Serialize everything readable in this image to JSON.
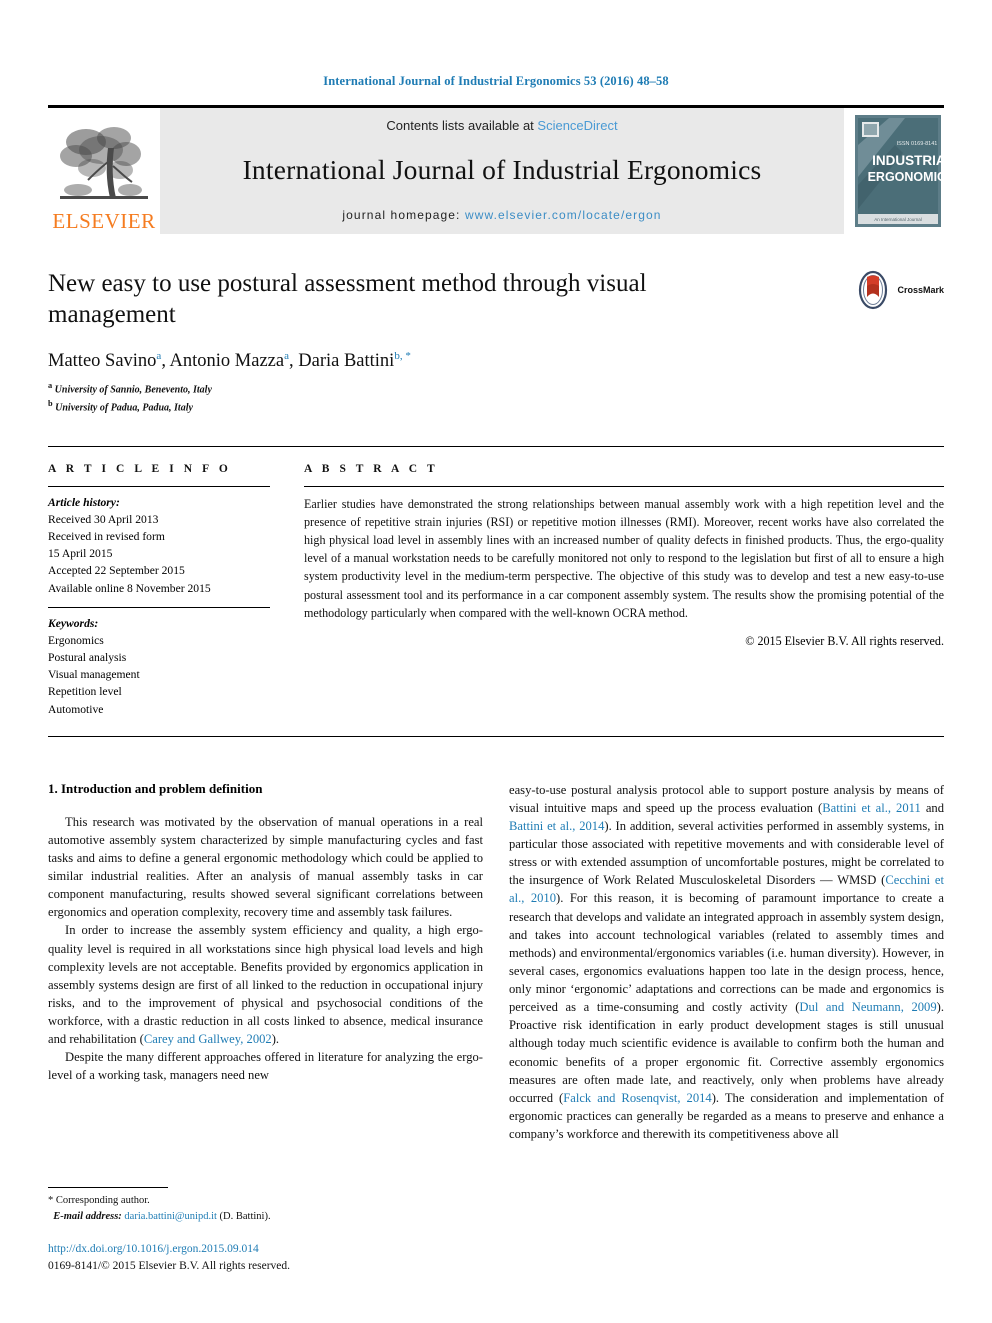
{
  "running_head": "International Journal of Industrial Ergonomics 53 (2016) 48–58",
  "masthead": {
    "contents_prefix": "Contents lists available at ",
    "sciencedirect": "ScienceDirect",
    "journal_name": "International Journal of Industrial Ergonomics",
    "homepage_prefix": "journal homepage: ",
    "homepage_url": "www.elsevier.com/locate/ergon",
    "publisher_word": "ELSEVIER",
    "cover": {
      "issn_text": "ISSN 0169-8141",
      "line1": "INDUSTRIAL",
      "line2": "ERGONOMICS",
      "footer_text": "An International Journal"
    }
  },
  "title": "New easy to use postural assessment method through visual management",
  "authors": {
    "full_line": "Matteo Savino a, Antonio Mazza a, Daria Battini b, *",
    "list": [
      {
        "name": "Matteo Savino",
        "marks": "a"
      },
      {
        "name": "Antonio Mazza",
        "marks": "a"
      },
      {
        "name": "Daria Battini",
        "marks": "b, *"
      }
    ]
  },
  "affiliations": [
    {
      "mark": "a",
      "text": "University of Sannio, Benevento, Italy"
    },
    {
      "mark": "b",
      "text": "University of Padua, Padua, Italy"
    }
  ],
  "crossmark": {
    "label": "CrossMark"
  },
  "article_info": {
    "heading": "A R T I C L E  I N F O",
    "history_label": "Article history:",
    "history": [
      "Received 30 April 2013",
      "Received in revised form",
      "15 April 2015",
      "Accepted 22 September 2015",
      "Available online 8 November 2015"
    ],
    "keywords_label": "Keywords:",
    "keywords": [
      "Ergonomics",
      "Postural analysis",
      "Visual management",
      "Repetition level",
      "Automotive"
    ]
  },
  "abstract": {
    "heading": "A B S T R A C T",
    "text": "Earlier studies have demonstrated the strong relationships between manual assembly work with a high repetition level and the presence of repetitive strain injuries (RSI) or repetitive motion illnesses (RMI). Moreover, recent works have also correlated the high physical load level in assembly lines with an increased number of quality defects in finished products. Thus, the ergo-quality level of a manual workstation needs to be carefully monitored not only to respond to the legislation but first of all to ensure a high system productivity level in the medium-term perspective. The objective of this study was to develop and test a new easy-to-use postural assessment tool and its performance in a car component assembly system. The results show the promising potential of the methodology particularly when compared with the well-known OCRA method.",
    "copyright": "© 2015 Elsevier B.V. All rights reserved."
  },
  "section": {
    "heading": "1. Introduction and problem definition"
  },
  "left_column": {
    "para1": "This research was motivated by the observation of manual operations in a real automotive assembly system characterized by simple manufacturing cycles and fast tasks and aims to define a general ergonomic methodology which could be applied to similar industrial realities. After an analysis of manual assembly tasks in car component manufacturing, results showed several significant correlations between ergonomics and operation complexity, recovery time and assembly task failures.",
    "para2_a": "In order to increase the assembly system efficiency and quality, a high ergo-quality level is required in all workstations since high physical load levels and high complexity levels are not acceptable. Benefits provided by ergonomics application in assembly systems design are first of all linked to the reduction in occupational injury risks, and to the improvement of physical and psychosocial conditions of the workforce, with a drastic reduction in all costs linked to absence, medical insurance and rehabilitation (",
    "para2_cite": "Carey and Gallwey, 2002",
    "para2_b": ").",
    "para3": "Despite the many different approaches offered in literature for analyzing the ergo-level of a working task, managers need new"
  },
  "right_column": {
    "seg1": "easy-to-use postural analysis protocol able to support posture analysis by means of visual intuitive maps and speed up the process evaluation (",
    "cite1": "Battini et al., 2011",
    "seg2": " and ",
    "cite2": "Battini et al., 2014",
    "seg3": "). In addition, several activities performed in assembly systems, in particular those associated with repetitive movements and with considerable level of stress or with extended assumption of uncomfortable postures, might be correlated to the insurgence of Work Related Musculoskeletal Disorders — WMSD (",
    "cite3": "Cecchini et al., 2010",
    "seg4": "). For this reason, it is becoming of paramount importance to create a research that develops and validate an integrated approach in assembly system design, and takes into account technological variables (related to assembly times and methods) and environmental/ergonomics variables (i.e. human diversity). However, in several cases, ergonomics evaluations happen too late in the design process, hence, only minor ‘ergonomic’ adaptations and corrections can be made and ergonomics is perceived as a time-consuming and costly activity (",
    "cite4": "Dul and Neumann, 2009",
    "seg5": "). Proactive risk identification in early product development stages is still unusual although today much scientific evidence is available to confirm both the human and economic benefits of a proper ergonomic fit. Corrective assembly ergonomics measures are often made late, and reactively, only when problems have already occurred (",
    "cite5": "Falck and Rosenqvist, 2014",
    "seg6": "). The consideration and implementation of ergonomic practices can generally be regarded as a means to preserve and enhance a company’s workforce and therewith its competitiveness above all"
  },
  "footnote": {
    "corresponding": "* Corresponding author.",
    "email_label": "E-mail address:",
    "email": "daria.battini@unipd.it",
    "email_suffix": "(D. Battini).",
    "doi": "http://dx.doi.org/10.1016/j.ergon.2015.09.014",
    "issn_copyright": "0169-8141/© 2015 Elsevier B.V. All rights reserved."
  },
  "colors": {
    "link": "#1f7cb4",
    "sciencedirect": "#4a9ad4",
    "elsevier_orange": "#F57C20",
    "cover_teal": "#4b6e78"
  }
}
